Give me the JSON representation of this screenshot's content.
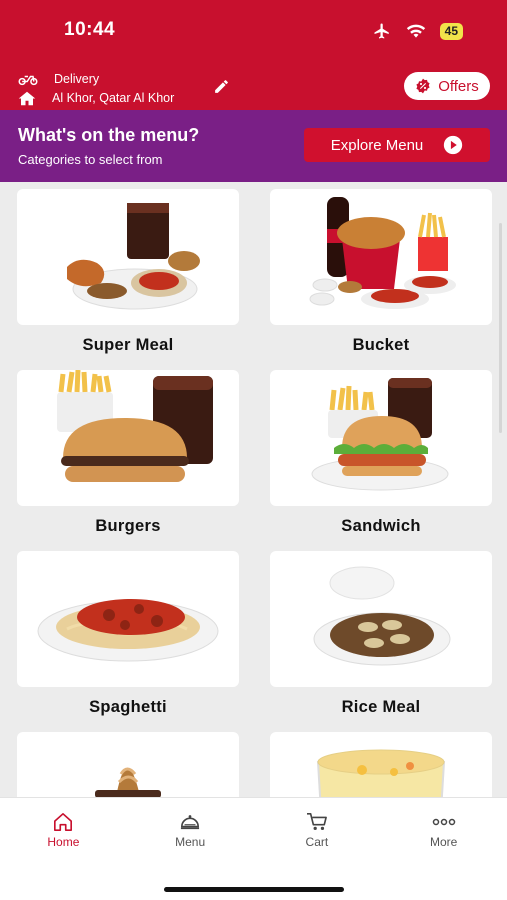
{
  "status_bar": {
    "time": "10:44",
    "battery": "45"
  },
  "header": {
    "delivery_label": "Delivery",
    "address": "Al Khor, Qatar Al Khor",
    "offers_label": "Offers"
  },
  "banner": {
    "title": "What's on the menu?",
    "subtitle": "Categories to select from",
    "explore_label": "Explore Menu"
  },
  "categories": [
    {
      "label": "Super Meal"
    },
    {
      "label": "Bucket"
    },
    {
      "label": "Burgers"
    },
    {
      "label": "Sandwich"
    },
    {
      "label": "Spaghetti"
    },
    {
      "label": "Rice Meal"
    },
    {
      "label": ""
    },
    {
      "label": ""
    }
  ],
  "nav": [
    {
      "label": "Home",
      "icon": "home-icon",
      "active": true
    },
    {
      "label": "Menu",
      "icon": "cloche-icon",
      "active": false
    },
    {
      "label": "Cart",
      "icon": "cart-icon",
      "active": false
    },
    {
      "label": "More",
      "icon": "more-icon",
      "active": false
    }
  ],
  "colors": {
    "brand_red": "#c8102e",
    "banner_purple": "#7a1f86",
    "battery_yellow": "#f2e34a"
  }
}
